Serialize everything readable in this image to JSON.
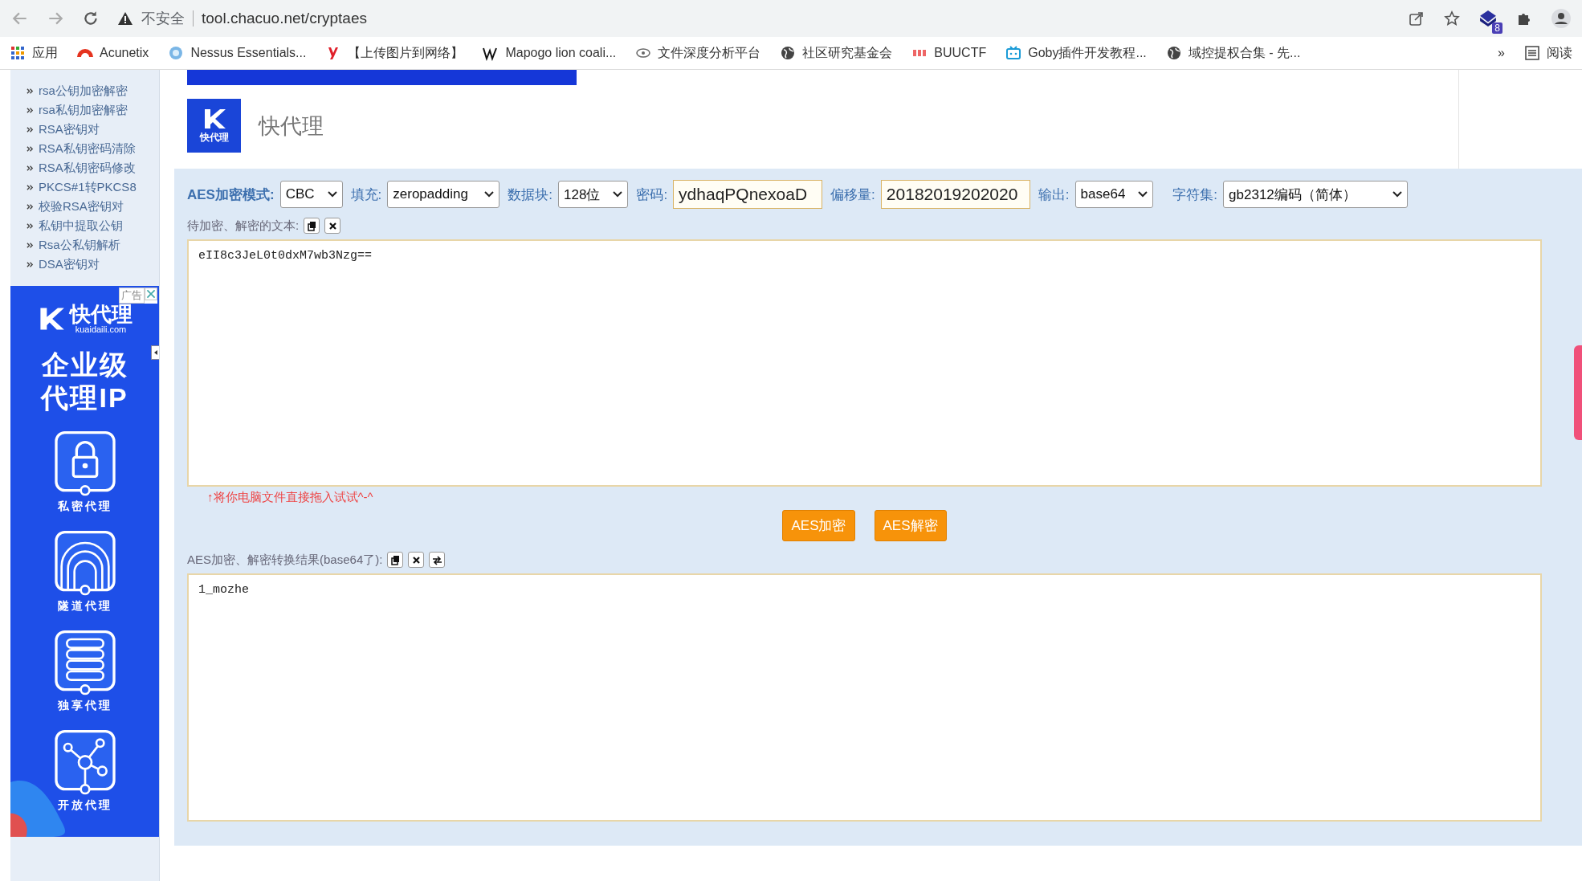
{
  "browser": {
    "security": "不安全",
    "url": "tool.chacuo.net/cryptaes",
    "extension_badge": "8",
    "bookmarks": [
      {
        "label": "应用"
      },
      {
        "label": "Acunetix"
      },
      {
        "label": "Nessus Essentials..."
      },
      {
        "label": "【上传图片到网络】"
      },
      {
        "label": "Mapogo lion coali..."
      },
      {
        "label": "文件深度分析平台"
      },
      {
        "label": "社区研究基金会"
      },
      {
        "label": "BUUCTF"
      },
      {
        "label": "Goby插件开发教程..."
      },
      {
        "label": "域控提权合集 - 先..."
      }
    ],
    "more": "»",
    "reading_list": "阅读"
  },
  "sidebar": {
    "items": [
      "rsa公钥加密解密",
      "rsa私钥加密解密",
      "RSA密钥对",
      "RSA私钥密码清除",
      "RSA私钥密码修改",
      "PKCS#1转PKCS8",
      "校验RSA密钥对",
      "私钥中提取公钥",
      "Rsa公私钥解析",
      "DSA密钥对"
    ]
  },
  "ad": {
    "tag": "广告",
    "brand": "快代理",
    "domain": "kuaidaili.com",
    "headline": [
      "企业级",
      "代理IP"
    ],
    "features": [
      "私密代理",
      "隧道代理",
      "独享代理",
      "开放代理"
    ]
  },
  "header": {
    "logo_text": "快代理",
    "site_name": "快代理"
  },
  "form": {
    "fields": [
      {
        "kind": "select",
        "label": "AES加密模式:",
        "value": "CBC"
      },
      {
        "kind": "select",
        "label": "填充:",
        "value": "zeropadding"
      },
      {
        "kind": "select",
        "label": "数据块:",
        "value": "128位"
      },
      {
        "kind": "input",
        "label": "密码:",
        "value": "ydhaqPQnexoaD"
      },
      {
        "kind": "input",
        "label": "偏移量:",
        "value": "20182019202020"
      },
      {
        "kind": "select",
        "label": "输出:",
        "value": "base64"
      },
      {
        "kind": "select",
        "label": "字符集:",
        "value": "gb2312编码（简体）"
      }
    ],
    "input_label": "待加密、解密的文本:",
    "input_text": "eII8c3JeL0t0dxM7wb3Nzg==",
    "hint": "↑将你电脑文件直接拖入试试^-^",
    "buttons": [
      "AES加密",
      "AES解密"
    ],
    "output_label": "AES加密、解密转换结果(base64了):",
    "output_text": "1_mozhe"
  }
}
